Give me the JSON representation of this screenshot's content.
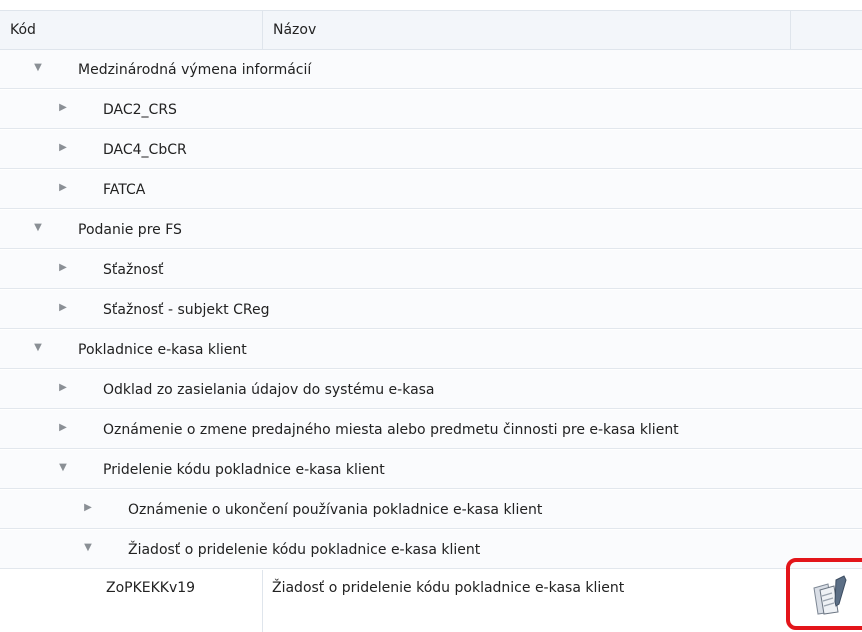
{
  "header": {
    "col_kod": "Kód",
    "col_nazov": "Názov"
  },
  "tree": [
    {
      "level": 0,
      "label": "Medzinárodná výmena informácií",
      "expanded": true
    },
    {
      "level": 1,
      "label": "DAC2_CRS",
      "expanded": false
    },
    {
      "level": 1,
      "label": "DAC4_CbCR",
      "expanded": false
    },
    {
      "level": 1,
      "label": "FATCA",
      "expanded": false
    },
    {
      "level": 0,
      "label": "Podanie pre FS",
      "expanded": true
    },
    {
      "level": 1,
      "label": "Sťažnosť",
      "expanded": false
    },
    {
      "level": 1,
      "label": "Sťažnosť - subjekt CReg",
      "expanded": false
    },
    {
      "level": 0,
      "label": "Pokladnice e-kasa klient",
      "expanded": true
    },
    {
      "level": 1,
      "label": "Odklad zo zasielania údajov do systému e-kasa",
      "expanded": false
    },
    {
      "level": 1,
      "label": "Oznámenie o zmene predajného miesta alebo predmetu činnosti pre e-kasa klient",
      "expanded": false
    },
    {
      "level": 1,
      "label": "Pridelenie kódu pokladnice e-kasa klient",
      "expanded": true
    },
    {
      "level": 2,
      "label": "Oznámenie o ukončení používania pokladnice e-kasa klient",
      "expanded": false
    },
    {
      "level": 2,
      "label": "Žiadosť o pridelenie kódu pokladnice e-kasa klient",
      "expanded": true
    }
  ],
  "data_row": {
    "code": "ZoPKEKKv19",
    "name": "Žiadosť o pridelenie kódu pokladnice e-kasa klient",
    "action_icon": "document-sign-icon",
    "highlight_color": "#e3151a"
  },
  "icons": {
    "expanded": "▼",
    "collapsed": "▶"
  }
}
